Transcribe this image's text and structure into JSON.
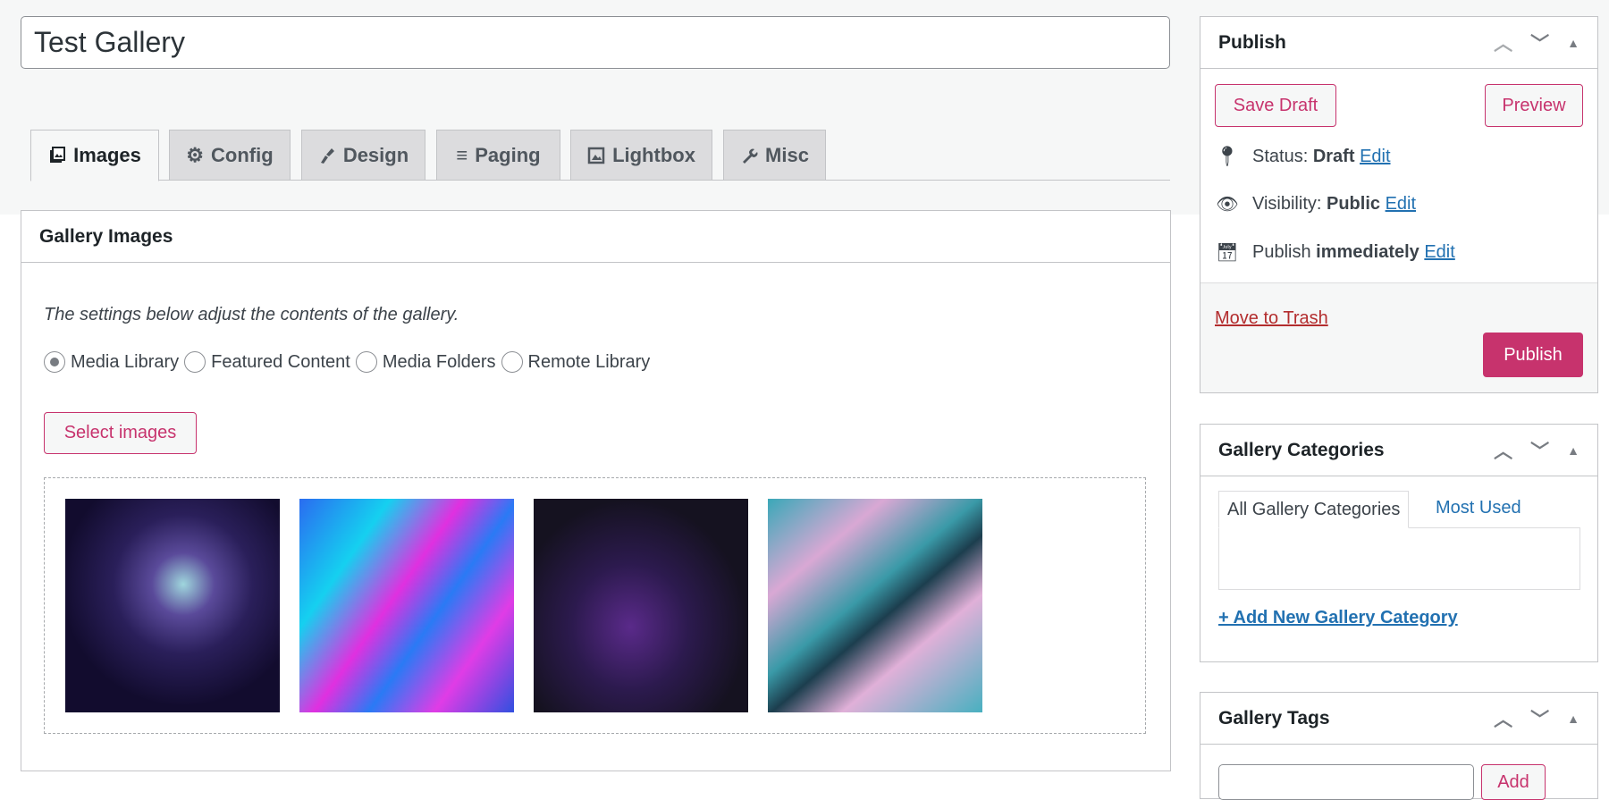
{
  "title": {
    "value": "Test Gallery"
  },
  "tabs": [
    {
      "label": "Images",
      "icon": "images-icon",
      "active": true
    },
    {
      "label": "Config",
      "icon": "gear-icon"
    },
    {
      "label": "Design",
      "icon": "brush-icon"
    },
    {
      "label": "Paging",
      "icon": "list-icon"
    },
    {
      "label": "Lightbox",
      "icon": "image-icon"
    },
    {
      "label": "Misc",
      "icon": "wrench-icon"
    }
  ],
  "gallery_images": {
    "title": "Gallery Images",
    "description": "The settings below adjust the contents of the gallery.",
    "sources": [
      {
        "label": "Media Library",
        "checked": true
      },
      {
        "label": "Featured Content"
      },
      {
        "label": "Media Folders"
      },
      {
        "label": "Remote Library"
      }
    ],
    "select_button": "Select images",
    "thumbnails": [
      "abstract-dark-purple",
      "abstract-blue-pink",
      "abstract-dark-streak",
      "abstract-marble-teal-pink"
    ]
  },
  "publish": {
    "title": "Publish",
    "save_draft": "Save Draft",
    "preview": "Preview",
    "status_label": "Status:",
    "status_value": "Draft",
    "visibility_label": "Visibility:",
    "visibility_value": "Public",
    "publish_label": "Publish",
    "publish_value": "immediately",
    "edit": "Edit",
    "trash": "Move to Trash",
    "publish_button": "Publish"
  },
  "categories": {
    "title": "Gallery Categories",
    "tab_all": "All Gallery Categories",
    "tab_used": "Most Used",
    "add_link": "+ Add New Gallery Category"
  },
  "tags": {
    "title": "Gallery Tags",
    "add_button": "Add"
  },
  "colors": {
    "accent": "#c7336d",
    "link": "#2271b1",
    "trash": "#b32d2e"
  }
}
